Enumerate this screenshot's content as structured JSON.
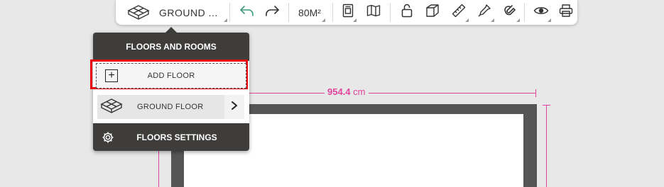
{
  "toolbar": {
    "floor_selector_label": "GROUND ...",
    "area_label": "80M²",
    "icons": [
      "floor-3d-icon",
      "undo-icon",
      "redo-icon",
      "floorplan-2d-icon",
      "map-icon",
      "lock-icon",
      "cube-3d-icon",
      "ruler-icon",
      "eyedropper-icon",
      "magnet-icon",
      "eye-icon",
      "print-icon"
    ]
  },
  "floors_panel": {
    "title": "FLOORS AND ROOMS",
    "add_floor_label": "ADD FLOOR",
    "floors": [
      {
        "label": "GROUND FLOOR"
      }
    ],
    "settings_label": "FLOORS SETTINGS"
  },
  "floorplan": {
    "dimension_value": "954.4",
    "dimension_unit": "cm"
  },
  "colors": {
    "dimension": "#e0449c",
    "panel_bg": "#3e3d3b",
    "highlight": "#e8000f",
    "wall": "#555555"
  }
}
